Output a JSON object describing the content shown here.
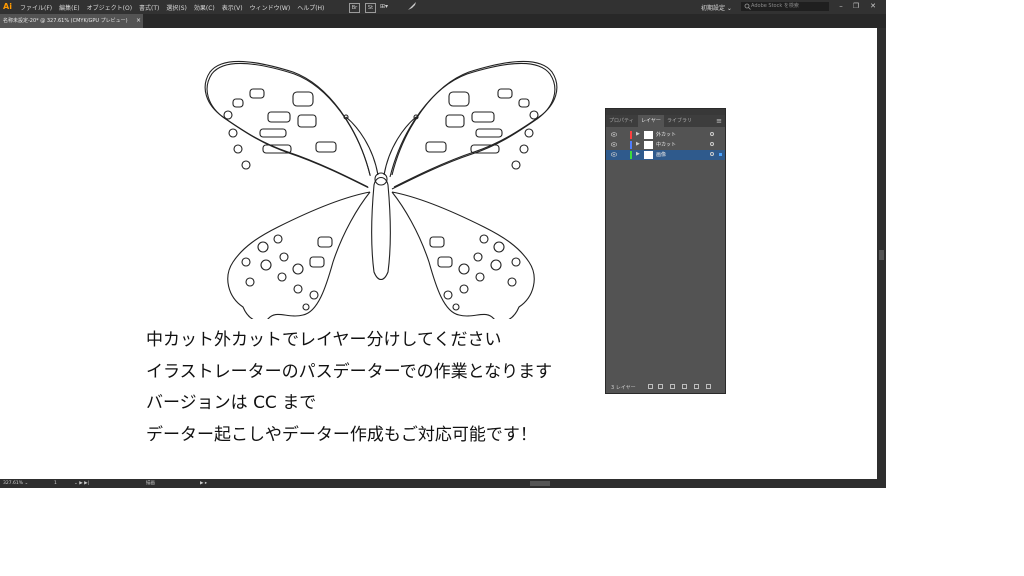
{
  "app": {
    "logo": "Ai"
  },
  "menu": {
    "items": [
      "ファイル(F)",
      "編集(E)",
      "オブジェクト(O)",
      "書式(T)",
      "選択(S)",
      "効果(C)",
      "表示(V)",
      "ウィンドウ(W)",
      "ヘルプ(H)"
    ],
    "bridge": "Br",
    "stock": "St",
    "arrange": "⊞▾",
    "workspace": "初期設定 ⌄",
    "search_placeholder": "Adobe Stock を検索"
  },
  "window_controls": {
    "minimize": "–",
    "restore": "❐",
    "close": "✕"
  },
  "document_tab": {
    "label": "名称未設定-20* @ 327.61% (CMYK/GPU プレビュー)",
    "close": "×"
  },
  "caption": {
    "line1": "中カット外カットでレイヤー分けしてください",
    "line2": "イラストレーターのパスデーターでの作業となります",
    "line3": "バージョンは CC まで",
    "line4": "データー起こしやデーター作成もご対応可能です！"
  },
  "status": {
    "zoom": "327.61% ⌄",
    "page": "1",
    "artboard_nav": "⌄ ▶ ▶|",
    "tool": "描画",
    "play": "▶ ▸"
  },
  "layers_panel": {
    "tabs": [
      "プロパティ",
      "レイヤー",
      "ライブラリ"
    ],
    "active_tab": "レイヤー",
    "menu_icon": "≡",
    "layers": [
      {
        "name": "外カット",
        "color": "#ff4040",
        "selected": false
      },
      {
        "name": "中カット",
        "color": "#4f7dff",
        "selected": false
      },
      {
        "name": "画像",
        "color": "#3ddc3d",
        "selected": true
      }
    ],
    "footer_label": "3 レイヤー"
  }
}
